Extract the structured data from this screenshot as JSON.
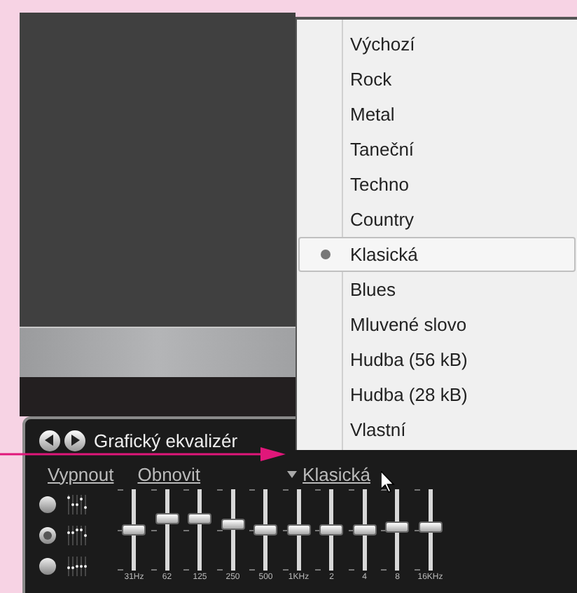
{
  "equalizer": {
    "title": "Grafický ekvalizér",
    "links": [
      "Vypnout",
      "Obnovit"
    ],
    "preset": "Klasická",
    "modes": [
      {
        "selected": false
      },
      {
        "selected": true
      },
      {
        "selected": false
      }
    ],
    "bands": [
      {
        "label": "31Hz",
        "level": 0.5
      },
      {
        "label": "62",
        "level": 0.67
      },
      {
        "label": "125",
        "level": 0.67
      },
      {
        "label": "250",
        "level": 0.58
      },
      {
        "label": "500",
        "level": 0.5
      },
      {
        "label": "1KHz",
        "level": 0.5
      },
      {
        "label": "2",
        "level": 0.5
      },
      {
        "label": "4",
        "level": 0.5
      },
      {
        "label": "8",
        "level": 0.55
      },
      {
        "label": "16KHz",
        "level": 0.55
      }
    ]
  },
  "menu": {
    "items": [
      {
        "label": "Výchozí",
        "selected": false
      },
      {
        "label": "Rock",
        "selected": false
      },
      {
        "label": "Metal",
        "selected": false
      },
      {
        "label": "Taneční",
        "selected": false
      },
      {
        "label": "Techno",
        "selected": false
      },
      {
        "label": "Country",
        "selected": false
      },
      {
        "label": "Klasická",
        "selected": true
      },
      {
        "label": "Blues",
        "selected": false
      },
      {
        "label": "Mluvené slovo",
        "selected": false
      },
      {
        "label": "Hudba (56 kB)",
        "selected": false
      },
      {
        "label": "Hudba (28 kB)",
        "selected": false
      },
      {
        "label": "Vlastní",
        "selected": false
      }
    ]
  }
}
